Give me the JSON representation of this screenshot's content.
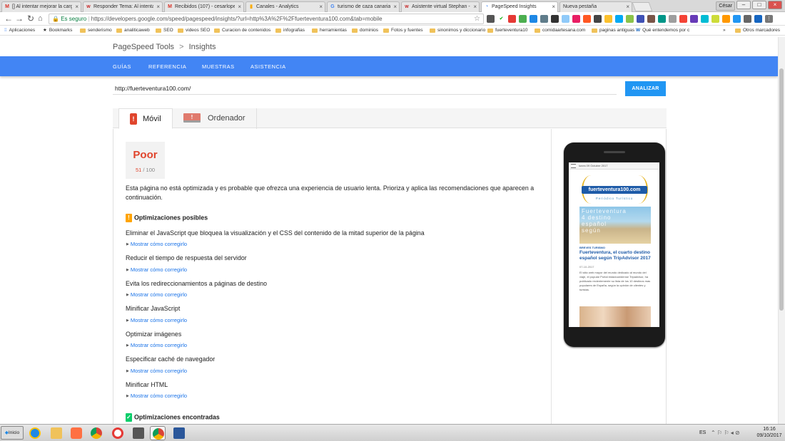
{
  "browser": {
    "tabs": [
      {
        "title": "[] Al intentar mejorar la carga",
        "icon": "gmail-icon",
        "active": false
      },
      {
        "title": "Responder Tema: Al intentar",
        "icon": "forum-icon",
        "active": false
      },
      {
        "title": "Recibidos (107) - cesarlopez",
        "icon": "gmail-icon",
        "active": false
      },
      {
        "title": "Canales - Analytics",
        "icon": "analytics-icon",
        "active": false
      },
      {
        "title": "turismo de caza canarias - G",
        "icon": "google-icon",
        "active": false
      },
      {
        "title": "Asistente virtual Stephan -",
        "icon": "forum-icon",
        "active": false
      },
      {
        "title": "PageSpeed Insights",
        "icon": "pagespeed-icon",
        "active": true
      },
      {
        "title": "Nueva pestaña",
        "icon": "newtab-icon",
        "active": false
      }
    ],
    "profile": "César",
    "omnibox": {
      "secure_label": "Es seguro",
      "url": "https://developers.google.com/speed/pagespeed/insights/?url=http%3A%2F%2Ffuerteventura100.com&tab=mobile"
    },
    "bookmarks": [
      "Aplicaciones",
      "Bookmarks",
      "senderismo",
      "analiticaweb",
      "SEO",
      "videos SEO",
      "Curacion de contenidos",
      "infografias",
      "herramientas",
      "dominios",
      "Fotos y fuentes",
      "sinonimos y diccionario",
      "fuerteventura10",
      "comidaartesana.com",
      "paginas antiguas",
      "Qué entendemos por c",
      "»",
      "Otros marcadores"
    ]
  },
  "page": {
    "breadcrumb": {
      "root": "PageSpeed Tools",
      "sep": ">",
      "current": "Insights"
    },
    "nav": [
      "GUÍAS",
      "REFERENCIA",
      "MUESTRAS",
      "ASISTENCIA"
    ],
    "url_input": "http://fuerteventura100.com/",
    "analyze_button": "ANALIZAR",
    "device_tabs": {
      "mobile": "Móvil",
      "desktop": "Ordenador"
    },
    "score": {
      "label": "Poor",
      "value": "51",
      "max": "/ 100"
    },
    "summary": "Esta página no está optimizada y es probable que ofrezca una experiencia de usuario lenta. Prioriza y aplica las recomendaciones que aparecen a continuación.",
    "possible_header": "Optimizaciones posibles",
    "found_header": "Optimizaciones encontradas",
    "fix_link": "Mostrar cómo corregirlo",
    "rules": [
      "Eliminar el JavaScript que bloquea la visualización y el CSS del contenido de la mitad superior de la página",
      "Reducir el tiempo de respuesta del servidor",
      "Evita los redireccionamientos a páginas de destino",
      "Minificar JavaScript",
      "Optimizar imágenes",
      "Especificar caché de navegador",
      "Minificar HTML"
    ],
    "preview": {
      "date": "lunes 09 Octubre 2017",
      "logo": "fuerteventura100.com",
      "tagline": "Periódico Turístico",
      "hero_text": "Fuerteventura 4 destino español según",
      "category": "BREVES TURISMO",
      "headline": "Fuerteventura, el cuarto destino español según TripAdvisor 2017",
      "post_date": "07-10-2017",
      "body": "El sitio web mayor del mundo dedicado al mundo del viaje, el popular Portal estadounidense Tripadvisor, ha publicado recientemente su lista de los 10 destinos mas populares de España, según la opinión de clientes y turistas."
    }
  },
  "taskbar": {
    "start": "Inicio",
    "language": "ES",
    "time": "16:16",
    "date": "09/10/2017"
  },
  "colors": {
    "nav_blue": "#4285f4",
    "poor_red": "#e0452d",
    "warn_orange": "#ffa400",
    "ok_green": "#0cce6b",
    "link_blue": "#1a73e8"
  }
}
